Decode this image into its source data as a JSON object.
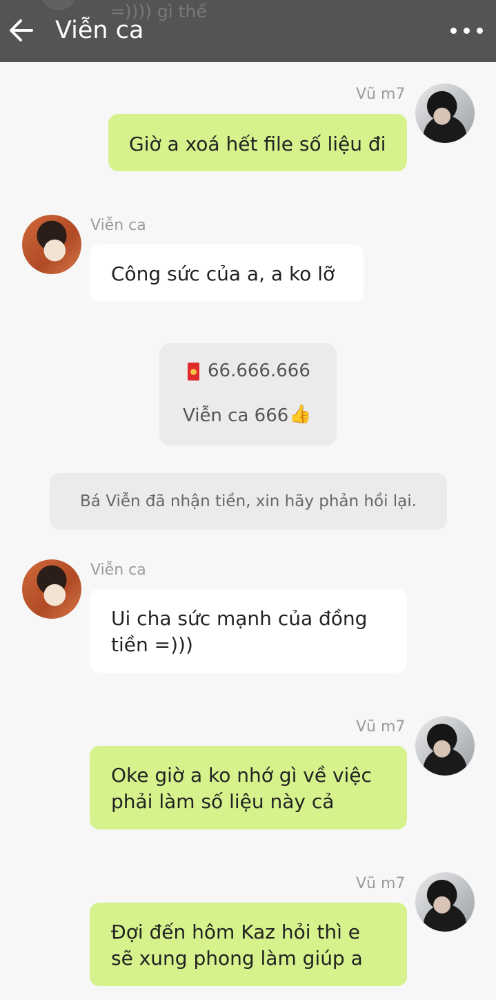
{
  "header": {
    "title": "Viễn ca",
    "ghost_text": "=)))) gì thế"
  },
  "messages": [
    {
      "sender": "Vũ m7",
      "lines": [
        "Giờ a xoá hết file số liệu đi"
      ]
    },
    {
      "sender": "Viễn ca",
      "lines": [
        "Công sức của a, a ko lỡ"
      ]
    },
    {
      "sender": "Viễn ca",
      "lines": [
        "Ui cha sức mạnh của đồng",
        "tiền =)))"
      ]
    },
    {
      "sender": "Vũ m7",
      "lines": [
        "Oke giờ a ko nhớ gì về việc",
        "phải làm số liệu này cả"
      ]
    },
    {
      "sender": "Vũ m7",
      "lines": [
        "Đợi đến hôm Kaz hỏi thì e",
        "sẽ xung phong làm giúp a"
      ]
    }
  ],
  "red_packet": {
    "amount": "66.666.666",
    "caption": "Viễn ca 666",
    "caption_emoji": "👍"
  },
  "notice": "Bá Viễn đã nhận tiền, xin hãy phản hồi lại.",
  "colors": {
    "header_bg": "#545454",
    "own_bubble": "#d6f28c",
    "other_bubble": "#ffffff",
    "background": "#f7f7f7"
  }
}
